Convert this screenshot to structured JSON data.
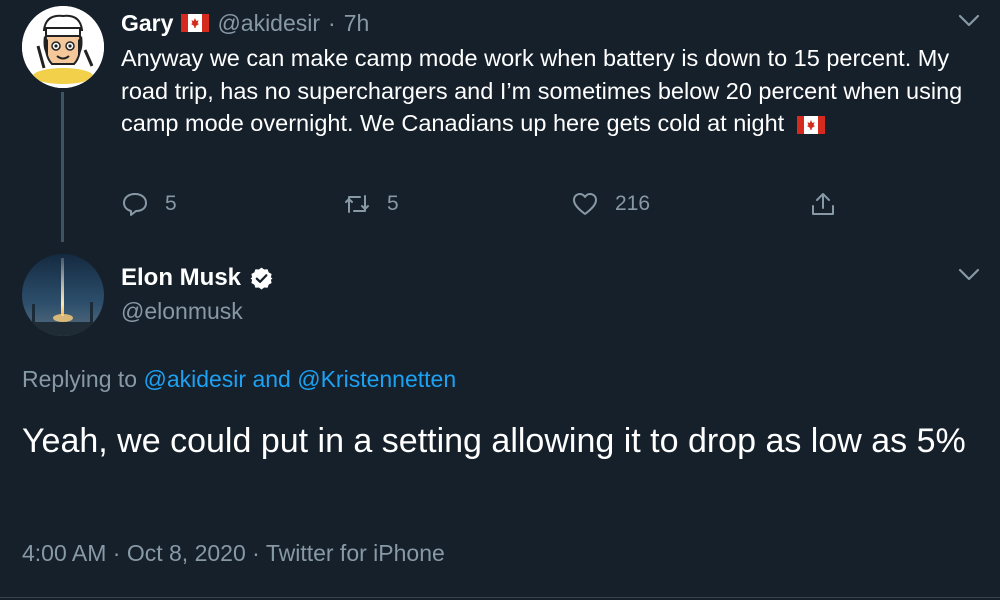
{
  "parent_tweet": {
    "author_name": "Gary",
    "handle": "@akidesir",
    "separator": "·",
    "time_ago": "7h",
    "text_main": "Anyway we can make camp mode work when battery is down to 15 percent.  My road trip, has no superchargers and I’m sometimes below 20 percent when using camp mode overnight.  We Canadians up here gets cold at night",
    "flag_icon": "canada-flag-icon",
    "actions": {
      "replies": "5",
      "retweets": "5",
      "likes": "216"
    }
  },
  "reply_tweet": {
    "author_name": "Elon Musk",
    "handle": "@elonmusk",
    "replying_prefix": "Replying to",
    "replying_user1": "@akidesir",
    "replying_and": "and",
    "replying_user2": "@Kristennetten",
    "text": "Yeah, we could put in a setting allowing it to drop as low as 5%",
    "time": "4:00 AM",
    "date": "Oct 8, 2020",
    "source": "Twitter for iPhone",
    "separator": "·"
  },
  "colors": {
    "background": "#15202b",
    "muted": "#8899a6",
    "link": "#1da1f2",
    "text": "#ffffff"
  }
}
